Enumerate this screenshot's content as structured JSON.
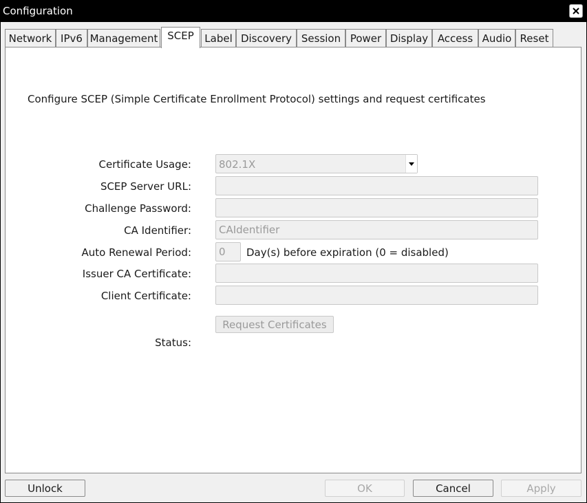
{
  "window": {
    "title": "Configuration",
    "close_icon": "close-icon"
  },
  "tabs": [
    {
      "label": "Network"
    },
    {
      "label": "IPv6"
    },
    {
      "label": "Management"
    },
    {
      "label": "SCEP",
      "active": true
    },
    {
      "label": "Label"
    },
    {
      "label": "Discovery"
    },
    {
      "label": "Session"
    },
    {
      "label": "Power"
    },
    {
      "label": "Display"
    },
    {
      "label": "Access"
    },
    {
      "label": "Audio"
    },
    {
      "label": "Reset"
    }
  ],
  "scep": {
    "description": "Configure SCEP (Simple Certificate Enrollment Protocol) settings and request certificates",
    "certificate_usage": {
      "label": "Certificate Usage:",
      "value": "802.1X"
    },
    "server_url": {
      "label": "SCEP Server URL:",
      "value": ""
    },
    "challenge_password": {
      "label": "Challenge Password:",
      "value": ""
    },
    "ca_identifier": {
      "label": "CA Identifier:",
      "value": "CAIdentifier"
    },
    "auto_renewal": {
      "label": "Auto Renewal Period:",
      "value": "0",
      "suffix": "Day(s) before expiration (0 = disabled)"
    },
    "issuer_ca_certificate": {
      "label": "Issuer CA Certificate:",
      "value": ""
    },
    "client_certificate": {
      "label": "Client Certificate:",
      "value": ""
    },
    "request_button": "Request Certificates",
    "status_label": "Status:"
  },
  "footer": {
    "unlock": "Unlock",
    "ok": "OK",
    "cancel": "Cancel",
    "apply": "Apply"
  },
  "colors": {
    "titlebar": "#000000",
    "panel": "#ffffff",
    "window_bg": "#f0f0f0",
    "disabled_text": "#9a9a9a"
  }
}
